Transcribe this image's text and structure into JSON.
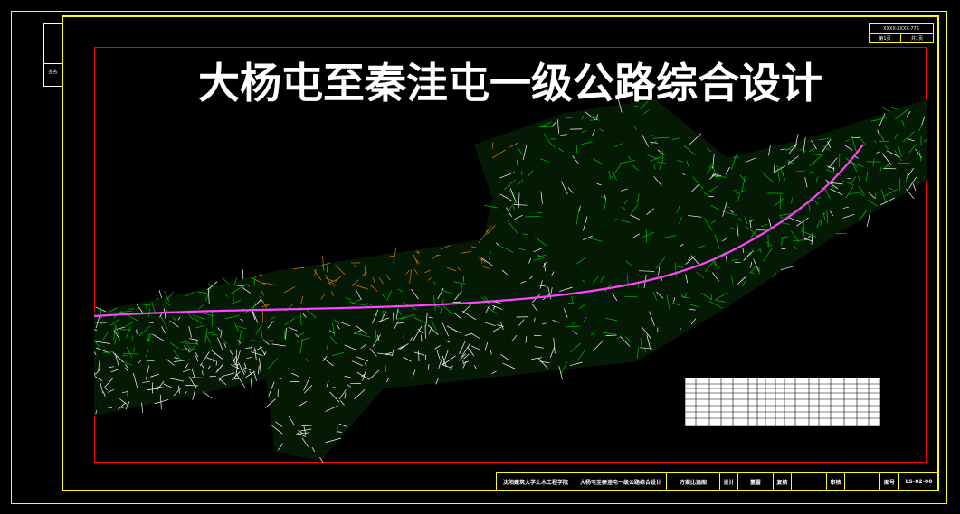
{
  "drawing": {
    "title": "大杨屯至秦洼屯一级公路综合设计",
    "side_tab_label": "签名",
    "top_block": {
      "code": "XXXX-XXXX-775",
      "page": "第1页",
      "total": "共1页"
    },
    "title_block": {
      "school": "沈阳建筑大学土木工程学院",
      "project": "大杨屯至秦洼屯一级公路综合设计",
      "drawing_name": "方案比选图",
      "design_label": "设计",
      "designer": "董雷",
      "check_label": "复核",
      "checker": "",
      "review_label": "审核",
      "reviewer": "",
      "number_label": "图号",
      "number": "LS-02-00"
    },
    "colors": {
      "frame": "#ffff00",
      "border": "#ff0000",
      "route": "#ff44ff",
      "terrain_green": "#00c000",
      "terrain_orange": "#d87a10",
      "lines": "#ffffff"
    }
  }
}
